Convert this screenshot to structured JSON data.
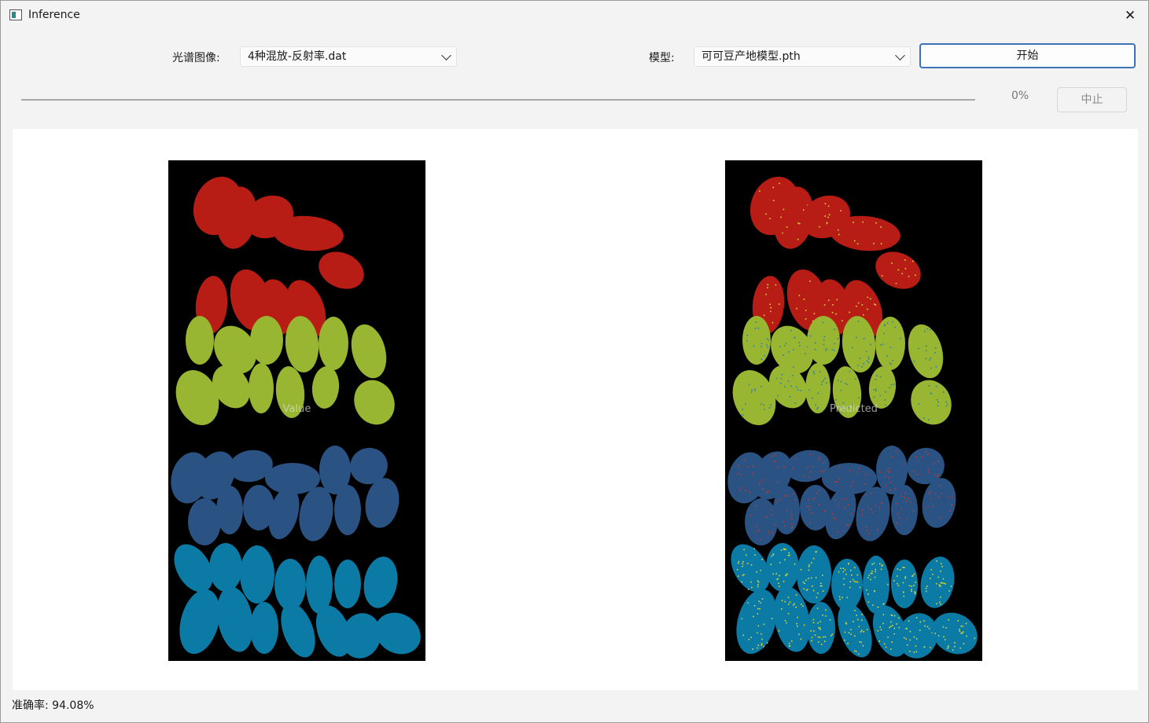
{
  "window": {
    "title": "Inference"
  },
  "controls": {
    "image_label": "光谱图像:",
    "image_value": "4种混放-反射率.dat",
    "model_label": "模型:",
    "model_value": "可可豆产地模型.pth",
    "start_label": "开始",
    "progress_text": "0%",
    "progress_value": 0,
    "stop_label": "中止"
  },
  "panels": {
    "left_caption": "Value",
    "right_caption": "Predicted"
  },
  "colors": {
    "class_red": "#b71c15",
    "class_green": "#98b632",
    "class_navy": "#2a5384",
    "class_teal": "#0b7aa5",
    "noise_yellow": "#d8d93a",
    "noise_blue": "#2d7ea8"
  },
  "status": {
    "accuracy": "准确率: 94.08%"
  }
}
